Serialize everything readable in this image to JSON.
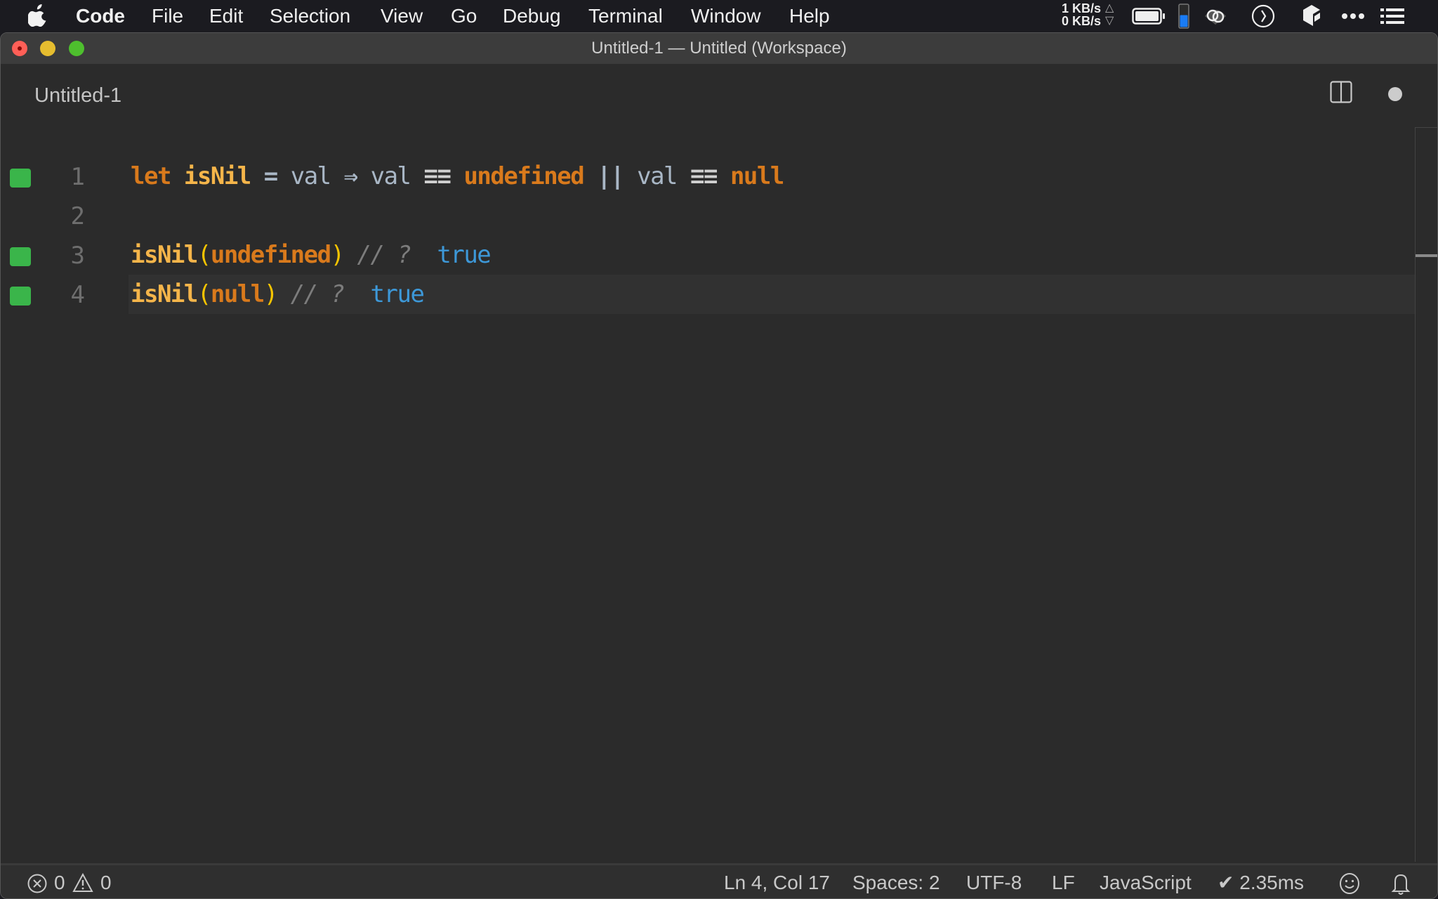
{
  "menubar": {
    "apple_icon": "apple-icon",
    "items": [
      "Code",
      "File",
      "Edit",
      "Selection",
      "View",
      "Go",
      "Debug",
      "Terminal",
      "Window",
      "Help"
    ],
    "network": {
      "up": "1 KB/s",
      "down": "0 KB/s",
      "up_arrow": "△",
      "down_arrow": "▽"
    },
    "tray_icons": [
      "battery-icon",
      "memory-gauge-icon",
      "creative-cloud-icon",
      "clock-icon",
      "app-icon",
      "more-icon",
      "list-icon"
    ],
    "memory_fill_fraction": 0.55
  },
  "window": {
    "title": "Untitled-1 — Untitled (Workspace)"
  },
  "tab": {
    "label": "Untitled-1",
    "split_icon": "split-editor-icon",
    "dirty_icon": "unsaved-dot-icon"
  },
  "editor": {
    "current_line": 4,
    "lines": [
      {
        "number": "1",
        "marker": true,
        "tokens": [
          {
            "t": "let",
            "c": "kw"
          },
          {
            "t": " ",
            "c": "id"
          },
          {
            "t": "isNil",
            "c": "fn"
          },
          {
            "t": " ",
            "c": "id"
          },
          {
            "t": "=",
            "c": "op"
          },
          {
            "t": " ",
            "c": "id"
          },
          {
            "t": "val",
            "c": "id"
          },
          {
            "t": " ",
            "c": "id"
          },
          {
            "t": "⇒",
            "c": "op"
          },
          {
            "t": " ",
            "c": "id"
          },
          {
            "t": "val",
            "c": "id"
          },
          {
            "t": " ",
            "c": "id"
          },
          {
            "t": "≡≡",
            "c": "eq3"
          },
          {
            "t": " ",
            "c": "id"
          },
          {
            "t": "undefined",
            "c": "kw"
          },
          {
            "t": " ",
            "c": "id"
          },
          {
            "t": "||",
            "c": "op"
          },
          {
            "t": " ",
            "c": "id"
          },
          {
            "t": "val",
            "c": "id"
          },
          {
            "t": " ",
            "c": "id"
          },
          {
            "t": "≡≡",
            "c": "eq3"
          },
          {
            "t": " ",
            "c": "id"
          },
          {
            "t": "null",
            "c": "kw"
          }
        ]
      },
      {
        "number": "2",
        "marker": false,
        "tokens": []
      },
      {
        "number": "3",
        "marker": true,
        "tokens": [
          {
            "t": "isNil",
            "c": "fn"
          },
          {
            "t": "(",
            "c": "paren"
          },
          {
            "t": "undefined",
            "c": "kw"
          },
          {
            "t": ")",
            "c": "paren"
          },
          {
            "t": " ",
            "c": "id"
          },
          {
            "t": "// ?",
            "c": "cmt"
          },
          {
            "t": "  ",
            "c": "id"
          },
          {
            "t": "true",
            "c": "result"
          }
        ]
      },
      {
        "number": "4",
        "marker": true,
        "tokens": [
          {
            "t": "isNil",
            "c": "fn"
          },
          {
            "t": "(",
            "c": "paren"
          },
          {
            "t": "null",
            "c": "kw"
          },
          {
            "t": ")",
            "c": "paren"
          },
          {
            "t": " ",
            "c": "id"
          },
          {
            "t": "// ?",
            "c": "cmt"
          },
          {
            "t": "  ",
            "c": "id"
          },
          {
            "t": "true",
            "c": "result"
          }
        ]
      }
    ]
  },
  "statusbar": {
    "errors": "0",
    "warnings": "0",
    "cursor": "Ln 4, Col 17",
    "indent": "Spaces: 2",
    "encoding": "UTF-8",
    "eol": "LF",
    "language": "JavaScript",
    "quokka": "✔ 2.35ms"
  },
  "colors": {
    "coverage_marker": "#3ab54a",
    "keyword": "#d97a1c",
    "function": "#f5b54a",
    "result": "#3d98d8"
  }
}
